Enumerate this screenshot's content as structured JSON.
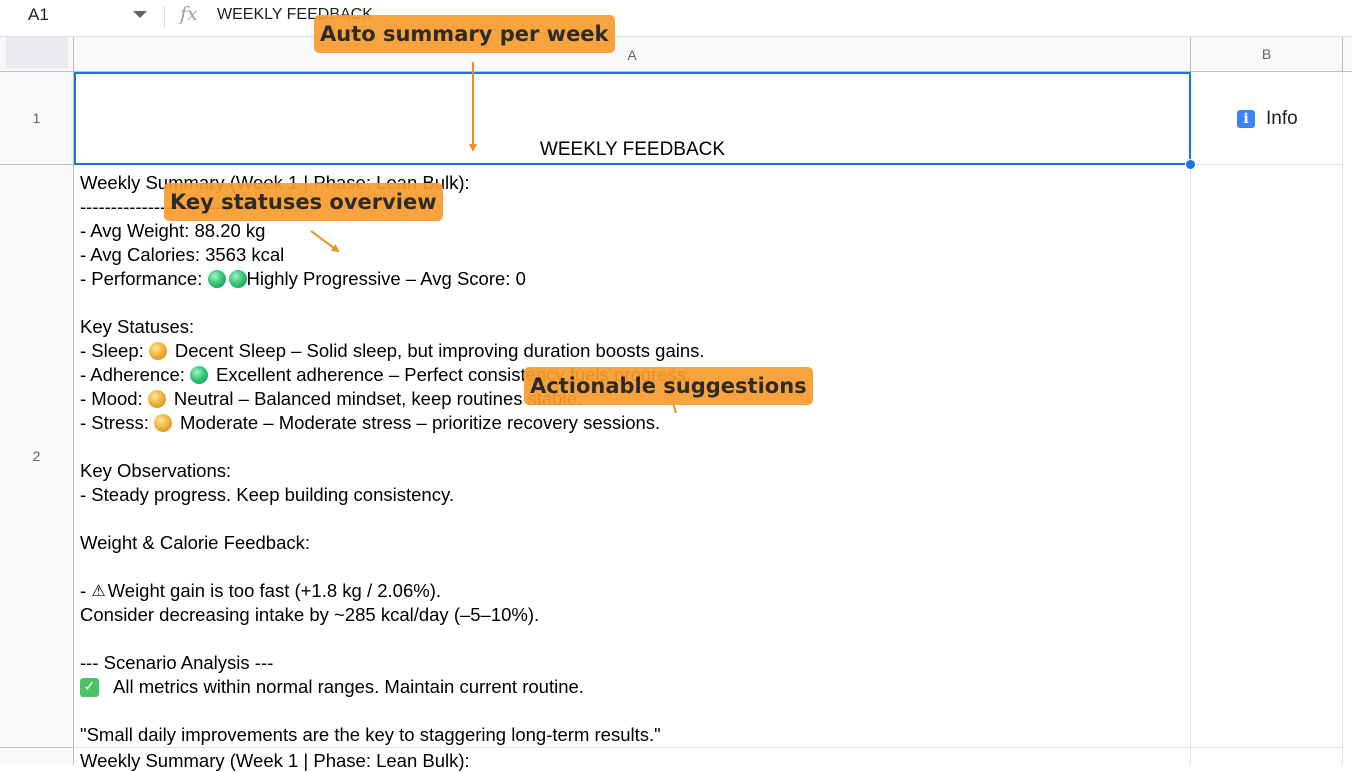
{
  "formula_bar": {
    "name_box": "A1",
    "fx_icon": "function-icon",
    "value": "WEEKLY FEEDBACK"
  },
  "columns": [
    "A",
    "B"
  ],
  "rows": [
    "1",
    "2"
  ],
  "cells": {
    "A1": "WEEKLY FEEDBACK",
    "B1": {
      "icon": "information-icon",
      "label": "Info"
    },
    "A2_lines": [
      "Weekly Summary (Week 1 | Phase: Lean Bulk):",
      "------------------------------",
      "- Avg Weight: 88.20 kg",
      "- Avg Calories: 3563 kcal",
      {
        "prefix": "- Performance: ",
        "status": "Highly Progressive – Avg Score: 0"
      },
      "",
      "Key Statuses:",
      {
        "prefix": "- Sleep: ",
        "status": "Decent Sleep – Solid sleep, but improving duration boosts gains."
      },
      {
        "prefix": "- Adherence: ",
        "status": "Excellent adherence – Perfect consistency fuels progress."
      },
      {
        "prefix": "- Mood: ",
        "status": "Neutral – Balanced mindset, keep routines stable."
      },
      {
        "prefix": "- Stress: ",
        "status": "Moderate – Moderate stress – prioritize recovery sessions."
      },
      "",
      "Key Observations:",
      "- Steady progress. Keep building consistency.",
      "",
      "Weight & Calorie Feedback:",
      "",
      {
        "prefix": "- ",
        "status": "Weight gain is too fast (+1.8 kg / 2.06%)."
      },
      "Consider decreasing intake by ~285 kcal/day (–5–10%).",
      "",
      "--- Scenario Analysis ---",
      {
        "prefix": "",
        "status": "All metrics within normal ranges. Maintain current routine."
      },
      "",
      "\"Small daily improvements are the key to staggering long-term results.\""
    ],
    "A3_partial": "Weekly Summary (Week 1 | Phase: Lean Bulk):"
  },
  "status_colors": {
    "green": "#34c77b",
    "yellow": "#f2b53a",
    "selection": "#1a73e8",
    "callout": "#f79d2f"
  },
  "annotations": [
    "Auto summary per week",
    "Key statuses overview",
    "Actionable suggestions"
  ]
}
